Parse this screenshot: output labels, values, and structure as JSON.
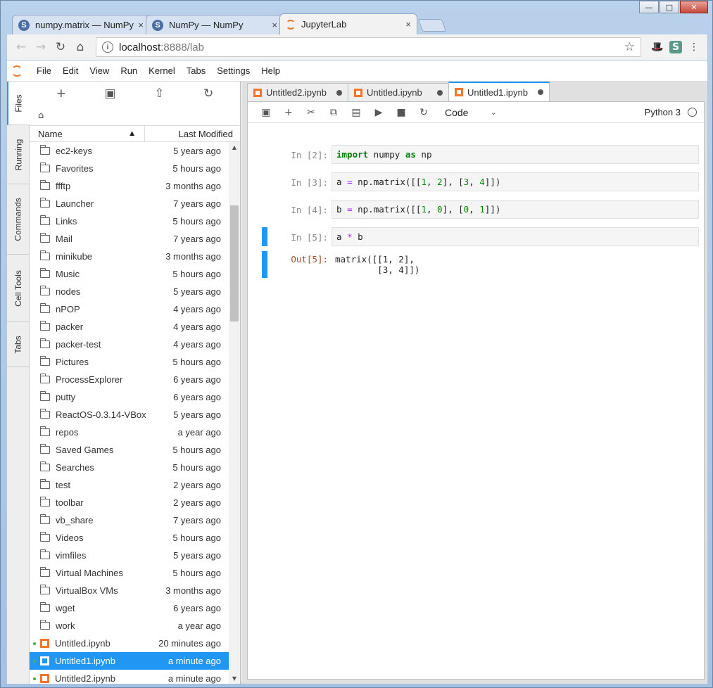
{
  "window": {
    "minimize_label": "—",
    "maximize_label": "□",
    "close_label": "✕"
  },
  "browser": {
    "tabs": [
      {
        "label": "numpy.matrix — NumPy",
        "favicon": "S",
        "close": "×"
      },
      {
        "label": "NumPy — NumPy",
        "favicon": "S",
        "close": "×"
      },
      {
        "label": "JupyterLab",
        "favicon": "",
        "close": "×"
      }
    ],
    "url_host": "localhost",
    "url_path": ":8888/lab",
    "nav": {
      "back": "←",
      "forward": "→",
      "reload": "↻",
      "home": "⌂",
      "star": "☆",
      "menu": "⋮"
    }
  },
  "menubar": {
    "items": [
      "File",
      "Edit",
      "View",
      "Run",
      "Kernel",
      "Tabs",
      "Settings",
      "Help"
    ]
  },
  "sidetabs": [
    "Files",
    "Running",
    "Commands",
    "Cell Tools",
    "Tabs"
  ],
  "filebrowser": {
    "toolbar": {
      "new_folder_hint": "+",
      "upload": "⇧",
      "refresh": "↻"
    },
    "breadcrumb_home": "⌂",
    "columns": {
      "name": "Name",
      "modified": "Last Modified",
      "sort_arrow": "▲"
    },
    "items": [
      {
        "name": "ec2-keys",
        "modified": "5 years ago",
        "type": "folder"
      },
      {
        "name": "Favorites",
        "modified": "5 hours ago",
        "type": "folder"
      },
      {
        "name": "ffftp",
        "modified": "3 months ago",
        "type": "folder"
      },
      {
        "name": "Launcher",
        "modified": "7 years ago",
        "type": "folder"
      },
      {
        "name": "Links",
        "modified": "5 hours ago",
        "type": "folder"
      },
      {
        "name": "Mail",
        "modified": "7 years ago",
        "type": "folder"
      },
      {
        "name": "minikube",
        "modified": "3 months ago",
        "type": "folder"
      },
      {
        "name": "Music",
        "modified": "5 hours ago",
        "type": "folder"
      },
      {
        "name": "nodes",
        "modified": "5 years ago",
        "type": "folder"
      },
      {
        "name": "nPOP",
        "modified": "4 years ago",
        "type": "folder"
      },
      {
        "name": "packer",
        "modified": "4 years ago",
        "type": "folder"
      },
      {
        "name": "packer-test",
        "modified": "4 years ago",
        "type": "folder"
      },
      {
        "name": "Pictures",
        "modified": "5 hours ago",
        "type": "folder"
      },
      {
        "name": "ProcessExplorer",
        "modified": "6 years ago",
        "type": "folder"
      },
      {
        "name": "putty",
        "modified": "6 years ago",
        "type": "folder"
      },
      {
        "name": "ReactOS-0.3.14-VBox",
        "modified": "5 years ago",
        "type": "folder"
      },
      {
        "name": "repos",
        "modified": "a year ago",
        "type": "folder"
      },
      {
        "name": "Saved Games",
        "modified": "5 hours ago",
        "type": "folder"
      },
      {
        "name": "Searches",
        "modified": "5 hours ago",
        "type": "folder"
      },
      {
        "name": "test",
        "modified": "2 years ago",
        "type": "folder"
      },
      {
        "name": "toolbar",
        "modified": "2 years ago",
        "type": "folder"
      },
      {
        "name": "vb_share",
        "modified": "7 years ago",
        "type": "folder"
      },
      {
        "name": "Videos",
        "modified": "5 hours ago",
        "type": "folder"
      },
      {
        "name": "vimfiles",
        "modified": "5 years ago",
        "type": "folder"
      },
      {
        "name": "Virtual Machines",
        "modified": "5 hours ago",
        "type": "folder"
      },
      {
        "name": "VirtualBox VMs",
        "modified": "3 months ago",
        "type": "folder"
      },
      {
        "name": "wget",
        "modified": "6 years ago",
        "type": "folder"
      },
      {
        "name": "work",
        "modified": "a year ago",
        "type": "folder"
      },
      {
        "name": "Untitled.ipynb",
        "modified": "20 minutes ago",
        "type": "notebook",
        "running": true
      },
      {
        "name": "Untitled1.ipynb",
        "modified": "a minute ago",
        "type": "notebook",
        "running": true,
        "selected": true
      },
      {
        "name": "Untitled2.ipynb",
        "modified": "a minute ago",
        "type": "notebook",
        "running": true
      }
    ]
  },
  "doc_tabs": [
    {
      "label": "Untitled2.ipynb"
    },
    {
      "label": "Untitled.ipynb"
    },
    {
      "label": "Untitled1.ipynb",
      "active": true
    }
  ],
  "notebook": {
    "toolbar": {
      "save": "💾",
      "insert": "+",
      "cut": "✂",
      "copy": "⧉",
      "paste": "📋",
      "run": "▶",
      "stop": "■",
      "restart": "↻"
    },
    "cell_type": "Code",
    "cell_type_caret": "⌄",
    "kernel": "Python 3",
    "cells": [
      {
        "prompt": "In [2]:",
        "code": "import numpy as np"
      },
      {
        "prompt": "In [3]:",
        "code": "a = np.matrix([[1, 2], [3, 4]])"
      },
      {
        "prompt": "In [4]:",
        "code": "b = np.matrix([[1, 0], [0, 1]])"
      },
      {
        "prompt": "In [5]:",
        "code": "a * b",
        "active": true
      },
      {
        "prompt": "Out[5]:",
        "output": "matrix([[1, 2],\n        [3, 4]])",
        "active": true
      }
    ]
  }
}
